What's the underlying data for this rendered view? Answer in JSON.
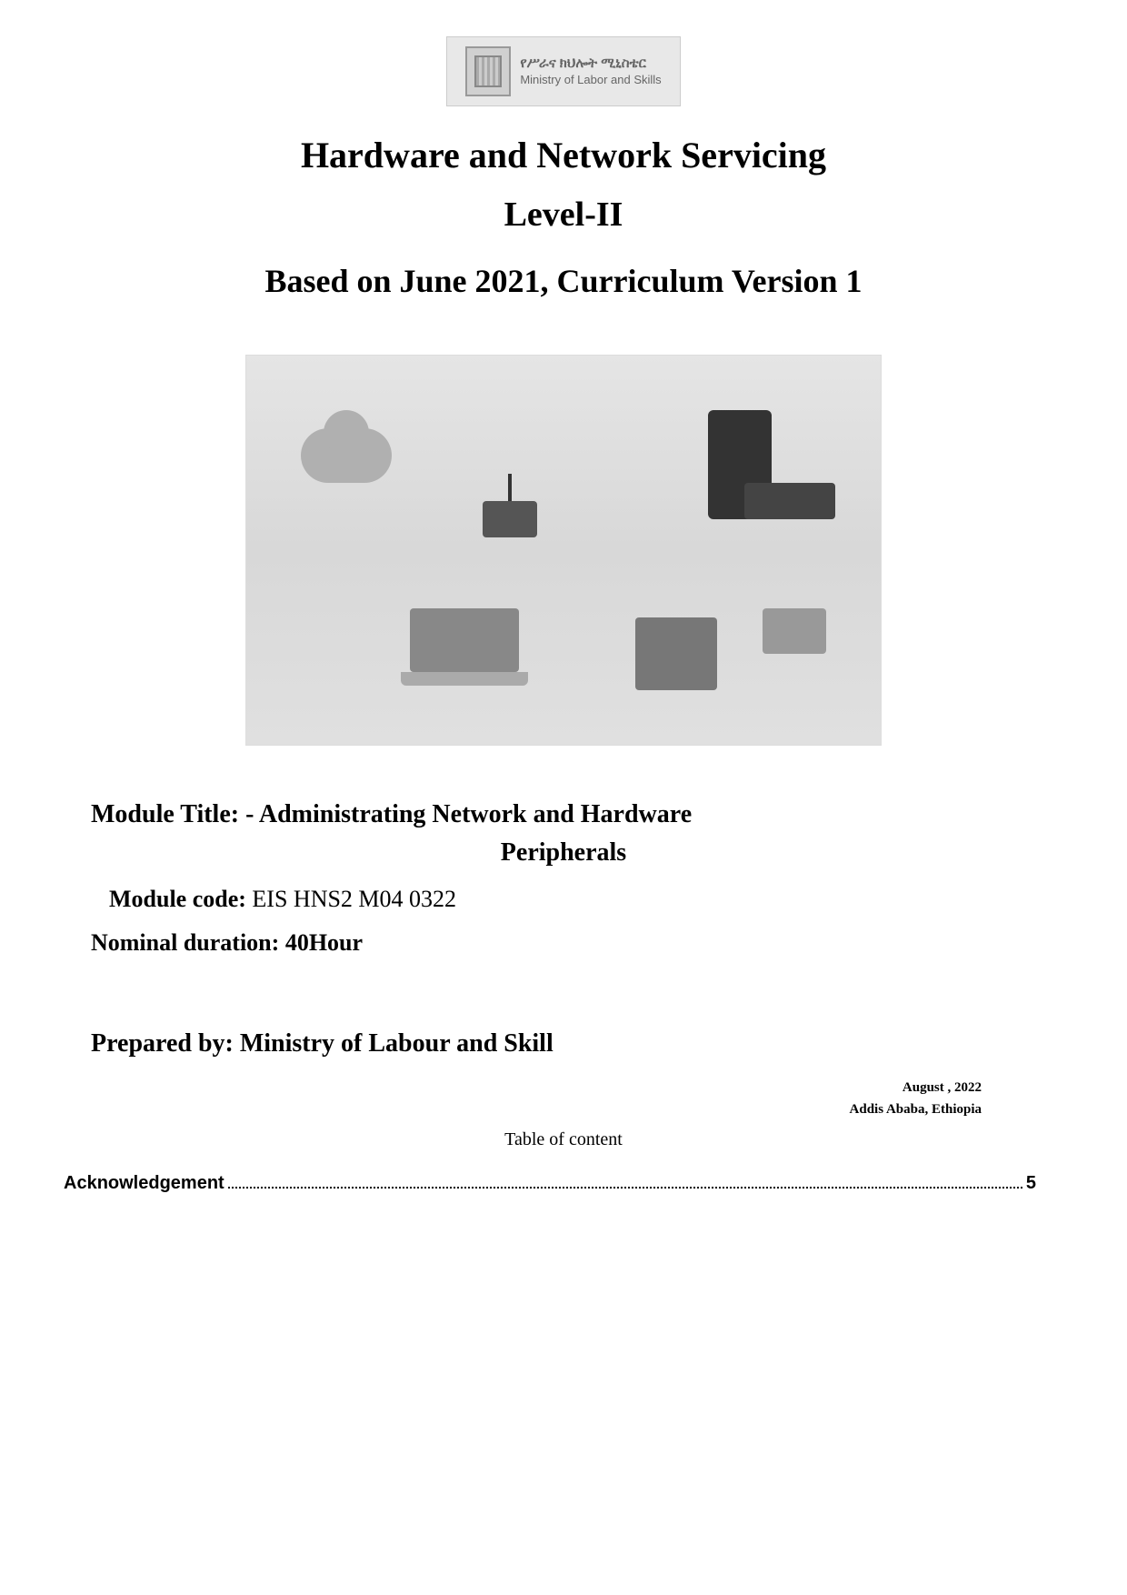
{
  "logo": {
    "amharic": "የሥራና ክህሎት ሚኒስቴር",
    "english": "Ministry of Labor and Skills"
  },
  "titles": {
    "line1": "Hardware and Network Servicing",
    "line2": "Level-II",
    "line3": "Based on June 2021, Curriculum Version 1"
  },
  "module": {
    "title_prefix": "Module Title: - ",
    "title_line1": "Administrating Network and Hardware",
    "title_line2": "Peripherals",
    "code_label": "Module code: ",
    "code_value": "EIS HNS2 M04 0322",
    "duration_label": "Nominal duration: ",
    "duration_value": "40Hour"
  },
  "prepared_by": "Prepared by: Ministry of Labour and Skill",
  "meta": {
    "date": "August , 2022",
    "location": "Addis Ababa, Ethiopia"
  },
  "toc": {
    "heading": "Table of content",
    "items": [
      {
        "label": "Acknowledgement",
        "page": "5"
      }
    ]
  }
}
